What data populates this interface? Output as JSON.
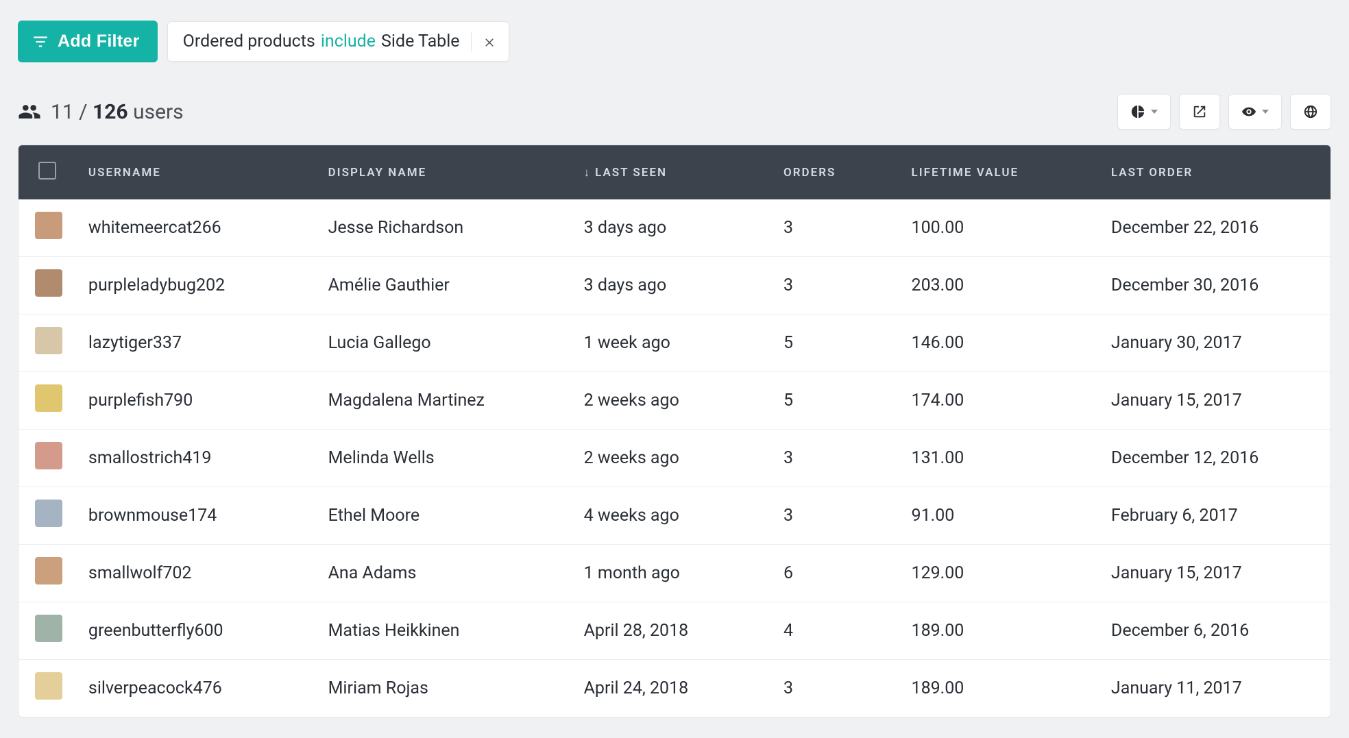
{
  "filters": {
    "add_button_label": "Add Filter",
    "chip": {
      "field": "Ordered products",
      "operator": "include",
      "value": "Side Table"
    }
  },
  "summary": {
    "filtered_count": "11",
    "separator": " / ",
    "total_count": "126",
    "entity_label": " users"
  },
  "columns": {
    "username": "USERNAME",
    "display_name": "DISPLAY NAME",
    "last_seen": "LAST SEEN",
    "orders": "ORDERS",
    "lifetime_value": "LIFETIME VALUE",
    "last_order": "LAST ORDER",
    "sort_indicator": "↓"
  },
  "avatar_colors": [
    "#c89b7b",
    "#b08b6d",
    "#d7c7a8",
    "#e0c76f",
    "#d49a8c",
    "#a5b3c2",
    "#caa07d",
    "#9fb3a8",
    "#e4cf9a"
  ],
  "rows": [
    {
      "username": "whitemeercat266",
      "display_name": "Jesse Richardson",
      "last_seen": "3 days ago",
      "orders": "3",
      "lifetime_value": "100.00",
      "last_order": "December 22, 2016"
    },
    {
      "username": "purpleladybug202",
      "display_name": "Amélie Gauthier",
      "last_seen": "3 days ago",
      "orders": "3",
      "lifetime_value": "203.00",
      "last_order": "December 30, 2016"
    },
    {
      "username": "lazytiger337",
      "display_name": "Lucia Gallego",
      "last_seen": "1 week ago",
      "orders": "5",
      "lifetime_value": "146.00",
      "last_order": "January 30, 2017"
    },
    {
      "username": "purplefish790",
      "display_name": "Magdalena Martinez",
      "last_seen": "2 weeks ago",
      "orders": "5",
      "lifetime_value": "174.00",
      "last_order": "January 15, 2017"
    },
    {
      "username": "smallostrich419",
      "display_name": "Melinda Wells",
      "last_seen": "2 weeks ago",
      "orders": "3",
      "lifetime_value": "131.00",
      "last_order": "December 12, 2016"
    },
    {
      "username": "brownmouse174",
      "display_name": "Ethel Moore",
      "last_seen": "4 weeks ago",
      "orders": "3",
      "lifetime_value": "91.00",
      "last_order": "February 6, 2017"
    },
    {
      "username": "smallwolf702",
      "display_name": "Ana Adams",
      "last_seen": "1 month ago",
      "orders": "6",
      "lifetime_value": "129.00",
      "last_order": "January 15, 2017"
    },
    {
      "username": "greenbutterfly600",
      "display_name": "Matias Heikkinen",
      "last_seen": "April 28, 2018",
      "orders": "4",
      "lifetime_value": "189.00",
      "last_order": "December 6, 2016"
    },
    {
      "username": "silverpeacock476",
      "display_name": "Miriam Rojas",
      "last_seen": "April 24, 2018",
      "orders": "3",
      "lifetime_value": "189.00",
      "last_order": "January 11, 2017"
    }
  ]
}
